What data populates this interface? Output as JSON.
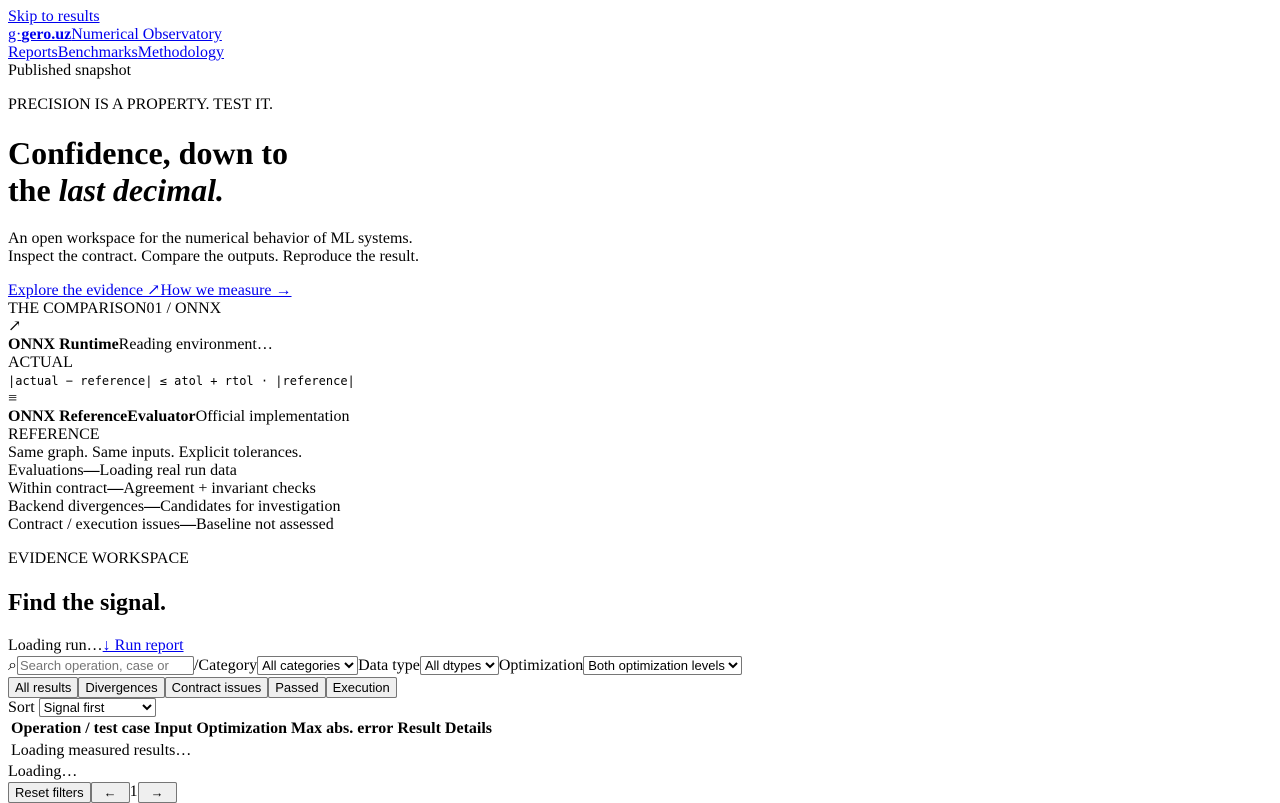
{
  "skip_link": "Skip to results",
  "brand": {
    "prefix": "g·",
    "name": "gero.uz",
    "product": "Numerical Observatory"
  },
  "nav": [
    "Reports",
    "Benchmarks",
    "Methodology"
  ],
  "status": "Published snapshot",
  "hero": {
    "kicker": "PRECISION IS A PROPERTY. TEST IT.",
    "title_line1": "Confidence, down to",
    "title_line2_pre": "the ",
    "title_line2_em": "last decimal.",
    "lede_line1": "An open workspace for the numerical behavior of ML systems.",
    "lede_line2": "Inspect the contract. Compare the outputs. Reproduce the result.",
    "cta_primary": "Explore the evidence ↗",
    "cta_secondary": "How we measure →"
  },
  "comparison": {
    "label": "THE COMPARISON",
    "index": "01 / ONNX",
    "arrow_icon": "↗",
    "actual_name": "ONNX Runtime",
    "actual_status": "Reading environment…",
    "actual_label": "ACTUAL",
    "formula": "|actual − reference| ≤ atol + rtol · |reference|",
    "equiv_icon": "≡",
    "reference_name": "ONNX ReferenceEvaluator",
    "reference_desc": "Official implementation",
    "reference_label": "REFERENCE",
    "summary": "Same graph. Same inputs. Explicit tolerances."
  },
  "stats": [
    {
      "label": "Evaluations",
      "value": "—",
      "desc": "Loading real run data"
    },
    {
      "label": "Within contract",
      "value": "—",
      "desc": "Agreement + invariant checks"
    },
    {
      "label": "Backend divergences",
      "value": "—",
      "desc": "Candidates for investigation"
    },
    {
      "label": "Contract / execution issues",
      "value": "—",
      "desc": "Baseline not assessed"
    }
  ],
  "workspace": {
    "kicker": "EVIDENCE WORKSPACE",
    "title": "Find the signal.",
    "run_status": "Loading run…",
    "run_report": "↓ Run report",
    "search_icon": "⌕",
    "search_placeholder": "Search operation, case or",
    "separator": "/",
    "category_label": "Category",
    "category_value": "All categories",
    "dtype_label": "Data type",
    "dtype_value": "All dtypes",
    "opt_label": "Optimization",
    "opt_value": "Both optimization levels",
    "tabs": [
      "All results",
      "Divergences",
      "Contract issues",
      "Passed",
      "Execution"
    ],
    "sort_label": "Sort",
    "sort_value": "Signal first",
    "columns": [
      "Operation / test case",
      "Input",
      "Optimization",
      "Max abs. error",
      "Result",
      "Details"
    ],
    "loading_rows": "Loading measured results…",
    "loading": "Loading…",
    "reset": "Reset filters",
    "prev": "←",
    "page": "1",
    "next": "→"
  }
}
